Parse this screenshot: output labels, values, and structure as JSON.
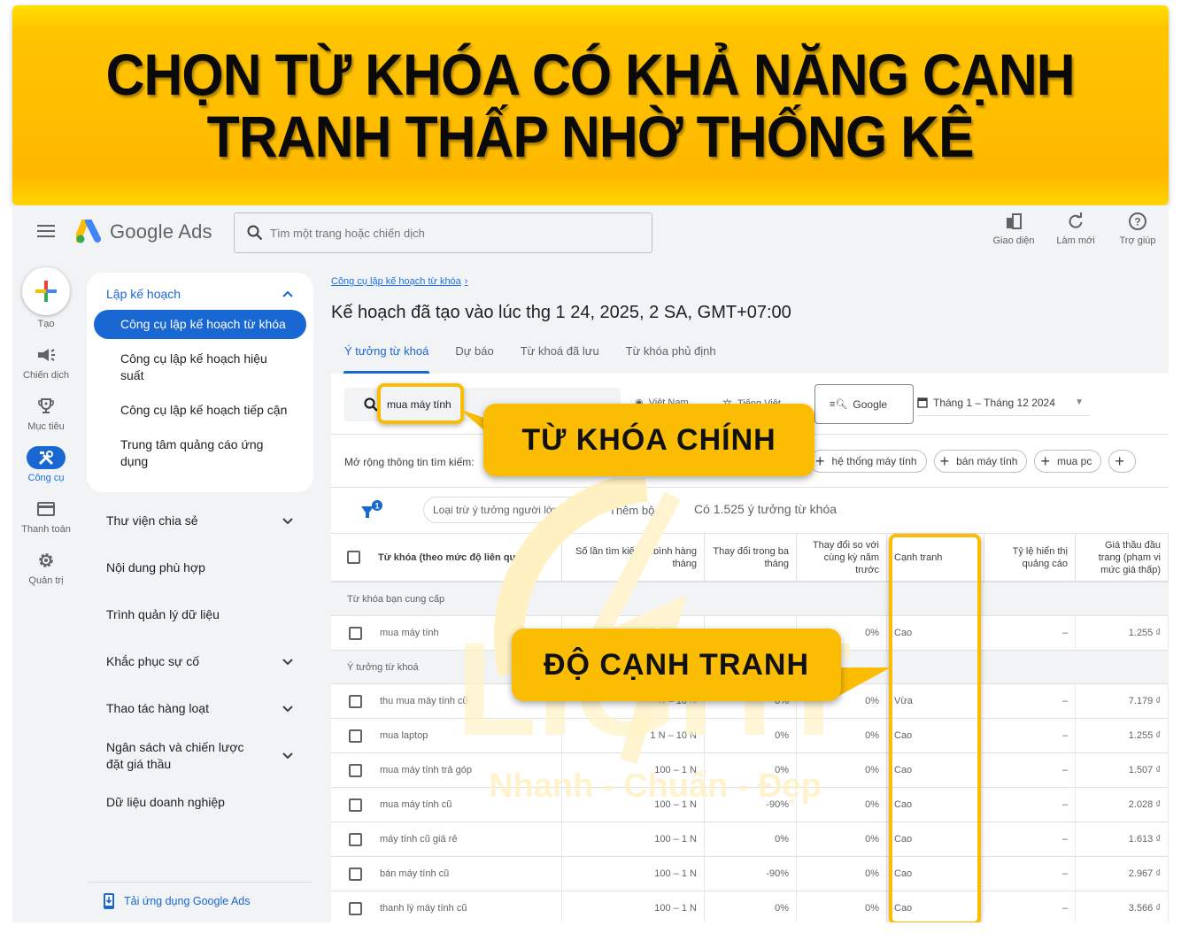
{
  "banner": {
    "line1": "CHỌN TỪ KHÓA CÓ KHẢ NĂNG CẠNH",
    "line2": "TRANH THẤP NHỜ THỐNG KÊ"
  },
  "header": {
    "app_name": "Google Ads",
    "search_placeholder": "Tìm một trang hoặc chiến dịch",
    "actions": [
      {
        "label": "Giao diện",
        "icon": "appearance-icon"
      },
      {
        "label": "Làm mới",
        "icon": "refresh-icon"
      },
      {
        "label": "Trợ giúp",
        "icon": "help-icon"
      }
    ]
  },
  "rail": {
    "items": [
      {
        "label": "Tạo",
        "icon": "plus-icon"
      },
      {
        "label": "Chiến dịch",
        "icon": "megaphone-icon"
      },
      {
        "label": "Mục tiêu",
        "icon": "trophy-icon"
      },
      {
        "label": "Công cụ",
        "icon": "tools-icon",
        "active": true
      },
      {
        "label": "Thanh toán",
        "icon": "credit-card-icon"
      },
      {
        "label": "Quản trị",
        "icon": "gear-icon"
      }
    ]
  },
  "nav": {
    "section_title": "Lập kế hoạch",
    "sub_items": [
      {
        "label": "Công cụ lập kế hoạch từ khóa",
        "active": true
      },
      {
        "label": "Công cụ lập kế hoạch hiệu suất"
      },
      {
        "label": "Công cụ lập kế hoạch tiếp cận"
      },
      {
        "label": "Trung tâm quảng cáo ứng dụng"
      }
    ],
    "groups": [
      {
        "label": "Thư viện chia sẻ",
        "expandable": true
      },
      {
        "label": "Nội dung phù hợp",
        "expandable": false
      },
      {
        "label": "Trình quản lý dữ liệu",
        "expandable": false
      },
      {
        "label": "Khắc phục sự cố",
        "expandable": true
      },
      {
        "label": "Thao tác hàng loạt",
        "expandable": true
      },
      {
        "label": "Ngân sách và chiến lược đặt giá thầu",
        "expandable": true
      },
      {
        "label": "Dữ liệu doanh nghiệp",
        "expandable": false
      }
    ],
    "app_link": "Tải ứng dụng Google Ads"
  },
  "main": {
    "breadcrumb": "Công cụ lập kế hoạch từ khóa",
    "title": "Kế hoạch đã tạo vào lúc thg 1 24, 2025, 2 SA, GMT+07:00",
    "tabs": [
      {
        "label": "Ý tưởng từ khoá",
        "active": true
      },
      {
        "label": "Dự báo"
      },
      {
        "label": "Từ khoá đã lưu"
      },
      {
        "label": "Từ khóa phủ định"
      }
    ],
    "keyword_search_value": "mua máy tính",
    "location": "Việt Nam",
    "language": "Tiếng Việt",
    "engine": "Google",
    "date_range": "Tháng 1 – Tháng 12 2024",
    "expand_label": "Mở rộng thông tin tìm kiếm:",
    "expand_chips": [
      "hệ thống máy tính",
      "bán máy tính",
      "mua pc"
    ],
    "filter_badge": "1",
    "exclude_chip": "Loại trừ ý tưởng người lớn",
    "add_filter": "Thêm bộ lọc",
    "idea_count": "Có 1.525 ý tưởng từ khóa"
  },
  "table": {
    "columns": [
      "Từ khóa (theo mức độ liên quan)",
      "Số lần tìm kiếm tr.bình hàng tháng",
      "Thay đổi trong ba tháng",
      "Thay đổi so với cùng kỳ năm trước",
      "Cạnh tranh",
      "Tỷ lệ hiển thị quảng cáo",
      "Giá thầu đầu trang (phạm vi mức giá thấp)"
    ],
    "section_provided": "Từ khóa bạn cung cấp",
    "provided_rows": [
      {
        "keyword": "mua máy tính",
        "volume": "",
        "three_month": "",
        "yoy": "0%",
        "competition": "Cao",
        "impression_share": "–",
        "bid_low": "1.255 ₫"
      }
    ],
    "section_ideas": "Ý tưởng từ khoá",
    "idea_rows": [
      {
        "keyword": "thu mua máy tính cũ",
        "volume": "1 N – 10 N",
        "three_month": "0%",
        "yoy": "0%",
        "competition": "Vừa",
        "impression_share": "–",
        "bid_low": "7.179 ₫"
      },
      {
        "keyword": "mua laptop",
        "volume": "1 N – 10 N",
        "three_month": "0%",
        "yoy": "0%",
        "competition": "Cao",
        "impression_share": "–",
        "bid_low": "1.255 ₫"
      },
      {
        "keyword": "mua máy tính trả góp",
        "volume": "100 – 1 N",
        "three_month": "0%",
        "yoy": "0%",
        "competition": "Cao",
        "impression_share": "–",
        "bid_low": "1.507 ₫"
      },
      {
        "keyword": "mua máy tính cũ",
        "volume": "100 – 1 N",
        "three_month": "-90%",
        "yoy": "0%",
        "competition": "Cao",
        "impression_share": "–",
        "bid_low": "2.028 ₫"
      },
      {
        "keyword": "máy tính cũ giá rẻ",
        "volume": "100 – 1 N",
        "three_month": "0%",
        "yoy": "0%",
        "competition": "Cao",
        "impression_share": "–",
        "bid_low": "1.613 ₫"
      },
      {
        "keyword": "bán máy tính cũ",
        "volume": "100 – 1 N",
        "three_month": "-90%",
        "yoy": "0%",
        "competition": "Cao",
        "impression_share": "–",
        "bid_low": "2.967 ₫"
      },
      {
        "keyword": "thanh lý máy tính cũ",
        "volume": "100 – 1 N",
        "three_month": "0%",
        "yoy": "0%",
        "competition": "Cao",
        "impression_share": "–",
        "bid_low": "3.566 ₫"
      }
    ]
  },
  "callouts": {
    "main_keyword": "TỪ KHÓA CHÍNH",
    "competition": "ĐỘ CẠNH TRANH"
  },
  "watermark": {
    "brand": "LIGHT",
    "slogan": "Nhanh - Chuẩn - Đẹp"
  },
  "colors": {
    "accent_blue": "#1967d2",
    "banner_yellow": "#ffb900",
    "callout_yellow": "#fbbc04"
  }
}
